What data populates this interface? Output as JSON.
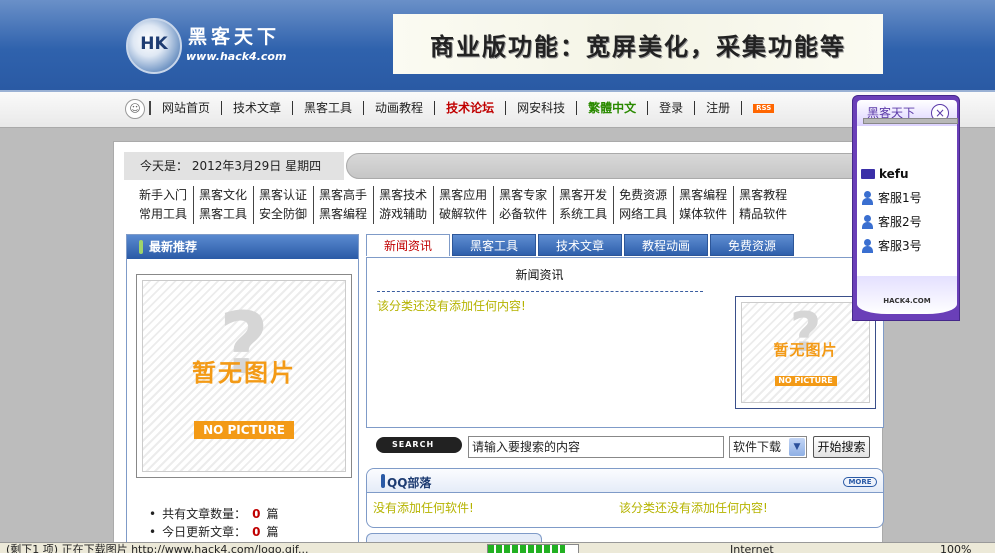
{
  "header": {
    "logo_hk": "HK",
    "logo_cn": "黑客天下",
    "logo_url": "www.hack4.com",
    "banner_text": "商业版功能：宽屏美化，采集功能等"
  },
  "nav": {
    "items": [
      {
        "label": "网站首页",
        "style": "normal"
      },
      {
        "label": "技术文章",
        "style": "normal"
      },
      {
        "label": "黑客工具",
        "style": "normal"
      },
      {
        "label": "动画教程",
        "style": "normal"
      },
      {
        "label": "技术论坛",
        "style": "red"
      },
      {
        "label": "网安科技",
        "style": "normal"
      },
      {
        "label": "繁體中文",
        "style": "green"
      },
      {
        "label": "登录",
        "style": "normal"
      },
      {
        "label": "注册",
        "style": "normal"
      }
    ],
    "rss": "RSS"
  },
  "date_bar": {
    "text": "今天是： 2012年3月29日  星期四"
  },
  "categories": {
    "row1": [
      "新手入门",
      "黑客文化",
      "黑客认证",
      "黑客高手",
      "黑客技术",
      "黑客应用",
      "黑客专家",
      "黑客开发",
      "免费资源",
      "黑客编程",
      "黑客教程"
    ],
    "row2": [
      "常用工具",
      "黑客工具",
      "安全防御",
      "黑客编程",
      "游戏辅助",
      "破解软件",
      "必备软件",
      "系统工具",
      "网络工具",
      "媒体软件",
      "精品软件"
    ]
  },
  "left_panel": {
    "title": "最新推荐",
    "nopic_cn": "暂无图片",
    "nopic_en": "NO PICTURE",
    "stats": [
      {
        "label": "共有文章数量：",
        "value": "0",
        "unit": "篇"
      },
      {
        "label": "今日更新文章：",
        "value": "0",
        "unit": "篇"
      }
    ]
  },
  "tabs": [
    "新闻资讯",
    "黑客工具",
    "技术文章",
    "教程动画",
    "免费资源"
  ],
  "tab_content": {
    "title": "新闻资讯",
    "empty_text": "该分类还没有添加任何内容!",
    "nopic_cn": "暂无图片",
    "nopic_en": "NO PICTURE"
  },
  "search": {
    "logo_text": "SEARCH",
    "input_value": "请输入要搜索的内容",
    "select_value": "软件下载",
    "button_label": "开始搜索"
  },
  "qq_section": {
    "title": "QQ部落",
    "more": "MORE",
    "left_text": "没有添加任何软件!",
    "right_text": "该分类还没有添加任何内容!"
  },
  "kefu": {
    "title": "黑客天下",
    "close": "×",
    "group": "kefu",
    "members": [
      "客服1号",
      "客服2号",
      "客服3号"
    ],
    "footer": "HACK4.COM"
  },
  "statusbar": {
    "text": "(剩下1 项) 正在下载图片 http://www.hack4.com/logo.gif...",
    "progress": 0.85,
    "zone": "Internet",
    "zoom": "100%"
  },
  "colors": {
    "header_blue": "#2f62ad",
    "link_red": "#c00000",
    "link_green": "#2a8a00",
    "empty_text": "#b5b300",
    "kefu_purple": "#6a3fb8"
  }
}
